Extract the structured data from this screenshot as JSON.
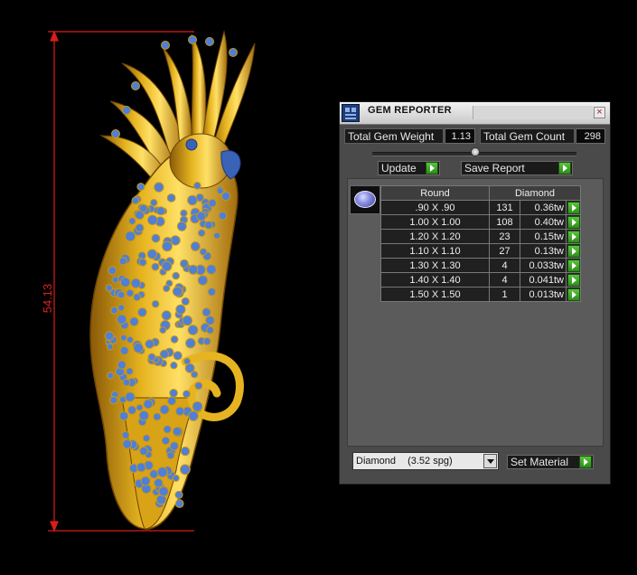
{
  "dimension": {
    "value": "54.13"
  },
  "window": {
    "title": "GEM REPORTER",
    "close_glyph": "×"
  },
  "totals": {
    "weight_label": "Total Gem Weight",
    "weight_value": "1.13",
    "count_label": "Total Gem Count",
    "count_value": "298"
  },
  "toolbar": {
    "update_label": "Update",
    "save_report_label": "Save Report"
  },
  "table": {
    "headers": {
      "shape": "Round",
      "material": "Diamond"
    },
    "rows": [
      {
        "size": ".90 X .90",
        "count": "131",
        "weight": "0.36tw"
      },
      {
        "size": "1.00 X 1.00",
        "count": "108",
        "weight": "0.40tw"
      },
      {
        "size": "1.20 X 1.20",
        "count": "23",
        "weight": "0.15tw"
      },
      {
        "size": "1.10 X 1.10",
        "count": "27",
        "weight": "0.13tw"
      },
      {
        "size": "1.30 X 1.30",
        "count": "4",
        "weight": "0.033tw"
      },
      {
        "size": "1.40 X 1.40",
        "count": "4",
        "weight": "0.041tw"
      },
      {
        "size": "1.50 X 1.50",
        "count": "1",
        "weight": "0.013tw"
      }
    ]
  },
  "material": {
    "selected_name": "Diamond",
    "selected_density": "(3.52 spg)",
    "set_label": "Set Material"
  },
  "colors": {
    "gold": "#e6b420",
    "gem_blue": "#4f7fd6",
    "dimension_red": "#e0201c",
    "go_green": "#3fa82a"
  }
}
